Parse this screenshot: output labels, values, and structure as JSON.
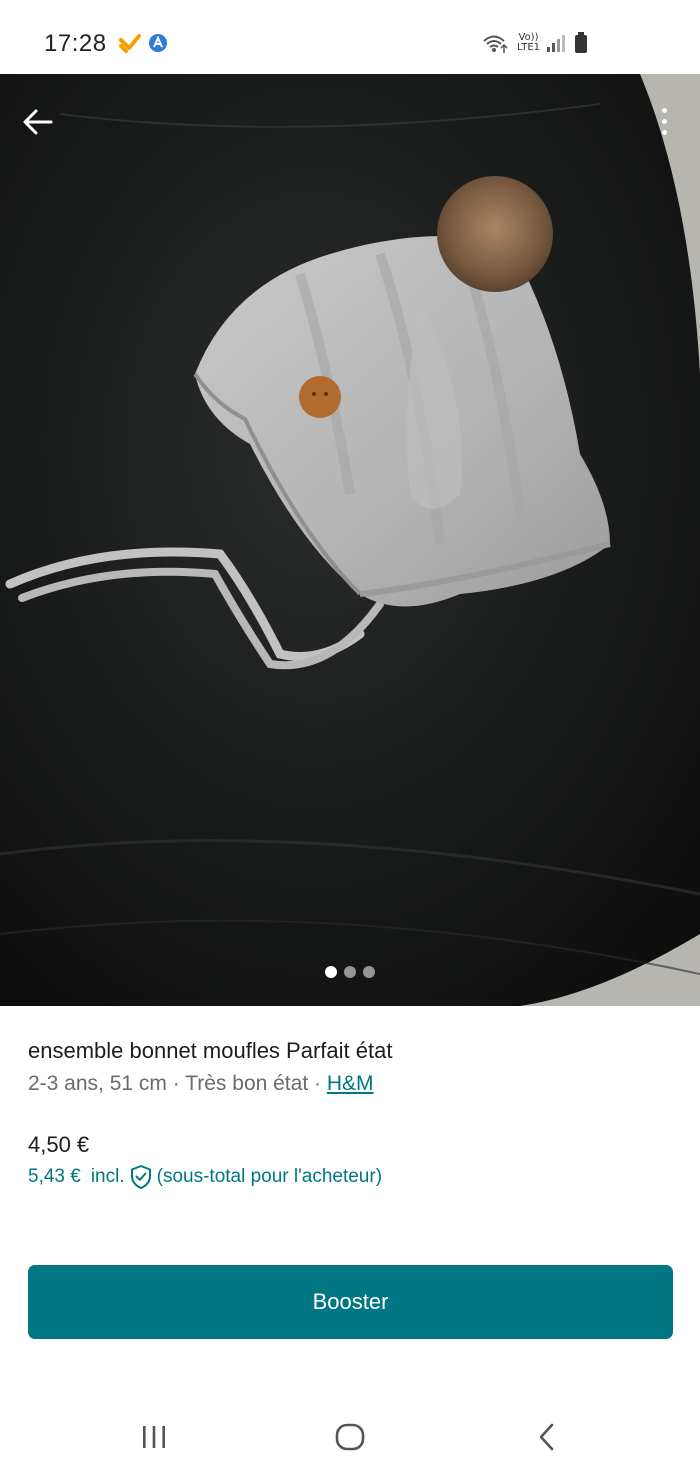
{
  "status_bar": {
    "time": "17:28",
    "lte_top": "Vo))",
    "lte_bottom": "LTE1"
  },
  "photo": {
    "alt_icons": [
      "back-arrow-icon",
      "more-vert-icon"
    ],
    "carousel_total": 3,
    "carousel_active": 1
  },
  "item": {
    "title": "ensemble bonnet moufles Parfait état",
    "size": "2-3 ans, 51 cm",
    "separator": " · ",
    "condition": "Très bon état",
    "brand": "H&M",
    "price": "4,50 €",
    "price_incl": "5,43 €",
    "incl_label": "incl.",
    "buyer_note": "(sous-total pour l'acheteur)"
  },
  "actions": {
    "boost_label": "Booster"
  },
  "colors": {
    "accent": "#007782",
    "text_primary": "#1d1d1d",
    "text_secondary": "#6b6b6b"
  }
}
